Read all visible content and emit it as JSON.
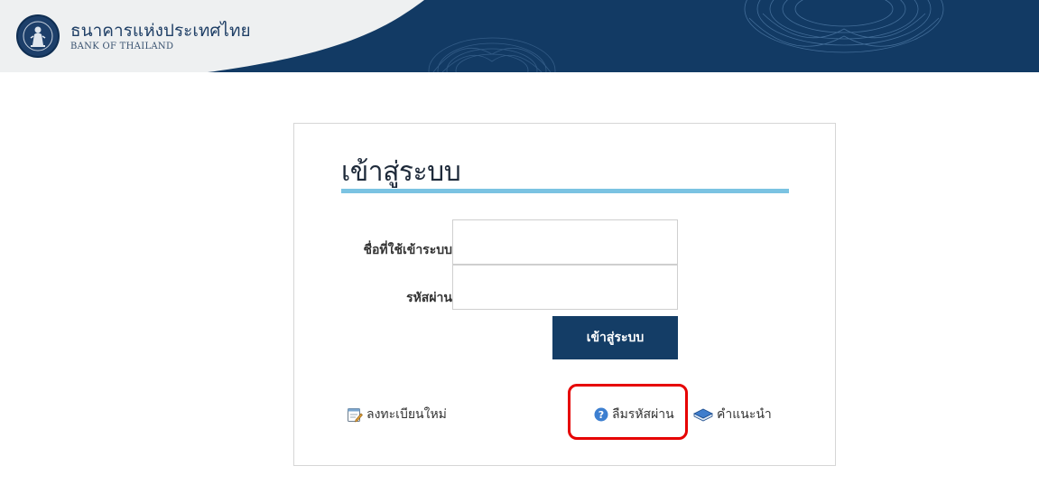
{
  "header": {
    "bank_name_thai": "ธนาคารแห่งประเทศไทย",
    "bank_name_en": "BANK OF THAILAND",
    "colors": {
      "band": "#123a64",
      "logo_panel": "#eef0f1"
    }
  },
  "login": {
    "title": "เข้าสู่ระบบ",
    "username_label": "ชื่อที่ใช้เข้าระบบ",
    "username_value": "",
    "password_label": "รหัสผ่าน",
    "password_value": "",
    "submit_label": "เข้าสู่ระบบ",
    "accent_color": "#7bc3e2",
    "button_color": "#143d66"
  },
  "links": {
    "register": {
      "label": "ลงทะเบียนใหม่",
      "icon": "edit-note-icon"
    },
    "forgot_password": {
      "label": "ลืมรหัสผ่าน",
      "icon": "help-circle-icon"
    },
    "guide": {
      "label": "คำแนะนำ",
      "icon": "book-icon"
    }
  },
  "annotation": {
    "highlight_color": "#e60000",
    "highlight_target": "forgot_password"
  }
}
